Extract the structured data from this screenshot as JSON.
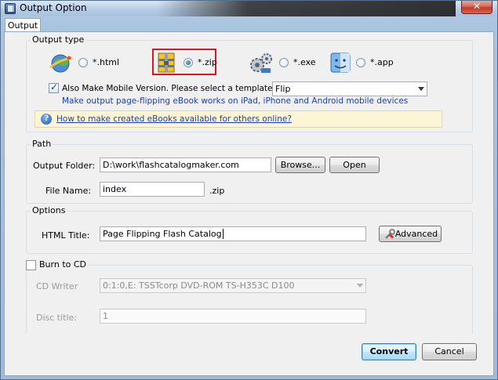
{
  "window": {
    "title": "Output Option",
    "close_symbol": "✕"
  },
  "tabs": [
    {
      "label": "Output"
    }
  ],
  "output_type": {
    "group_label": "Output type",
    "options": [
      {
        "label": "*.html",
        "selected": false
      },
      {
        "label": "*.zip",
        "selected": true
      },
      {
        "label": "*.exe",
        "selected": false
      },
      {
        "label": "*.app",
        "selected": false
      }
    ],
    "mobile": {
      "checkbox_label": "Also Make Mobile Version. Please select a template for mobile:",
      "checked": true,
      "template": "Flip",
      "note": "Make output page-flipping eBook works on iPad, iPhone and Android mobile devices"
    },
    "help_link": "How to make created eBooks available for others online?"
  },
  "path": {
    "group_label": "Path",
    "folder_label": "Output Folder:",
    "folder_value": "D:\\work\\flashcatalogmaker.com",
    "browse_label": "Browse...",
    "open_label": "Open",
    "file_label": "File Name:",
    "file_value": "index",
    "file_ext": ".zip"
  },
  "options": {
    "group_label": "Options",
    "html_title_label": "HTML Title:",
    "html_title_value": "Page Flipping Flash Catalog",
    "advanced_label": "Advanced"
  },
  "burn": {
    "checkbox_label": "Burn to CD",
    "checked": false,
    "writer_label": "CD Writer",
    "writer_value": "0:1:0,E: TSSTcorp DVD-ROM TS-H353C D100",
    "disc_label": "Disc title:",
    "disc_value": "1"
  },
  "footer": {
    "convert_label": "Convert",
    "cancel_label": "Cancel"
  },
  "colors": {
    "highlight_border": "#e0141e",
    "link": "#1a3fb0",
    "info_bg": "#fdf6d6"
  }
}
